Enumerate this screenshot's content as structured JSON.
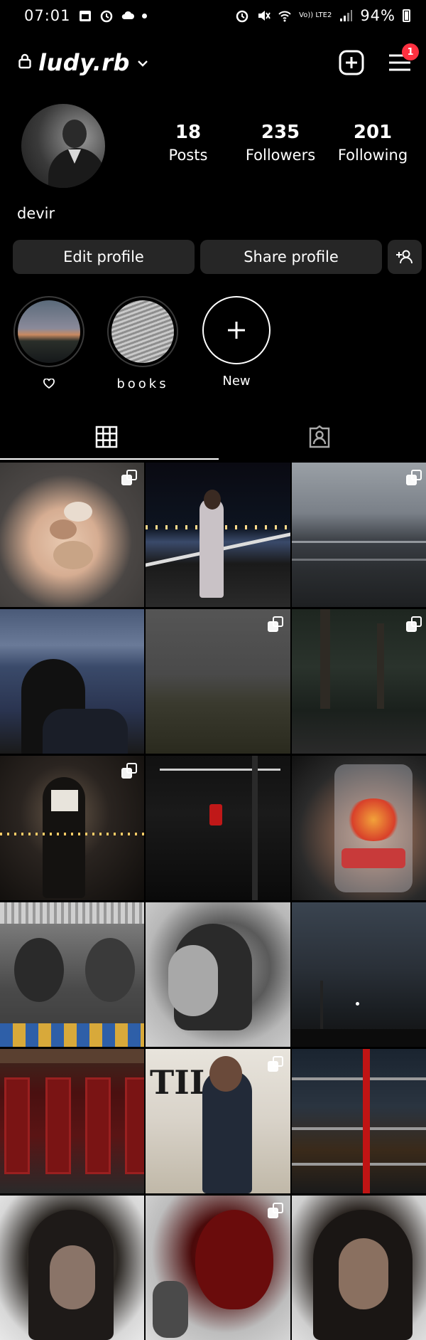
{
  "status_bar": {
    "time": "07:01",
    "network": "Vo)) LTE2",
    "battery": "94%"
  },
  "header": {
    "username": "ludy.rb",
    "notification_count": "1"
  },
  "profile": {
    "bio": "devir",
    "stats": [
      {
        "number": "18",
        "label": "Posts"
      },
      {
        "number": "235",
        "label": "Followers"
      },
      {
        "number": "201",
        "label": "Following"
      }
    ]
  },
  "actions": {
    "edit_profile": "Edit profile",
    "share_profile": "Share profile"
  },
  "highlights": [
    {
      "label": "♡"
    },
    {
      "label": "books"
    },
    {
      "label": "New"
    }
  ],
  "tabs": [
    "grid-icon",
    "tagged-icon"
  ],
  "accent": {
    "badge": "#ff3040",
    "button_bg": "#262626"
  }
}
